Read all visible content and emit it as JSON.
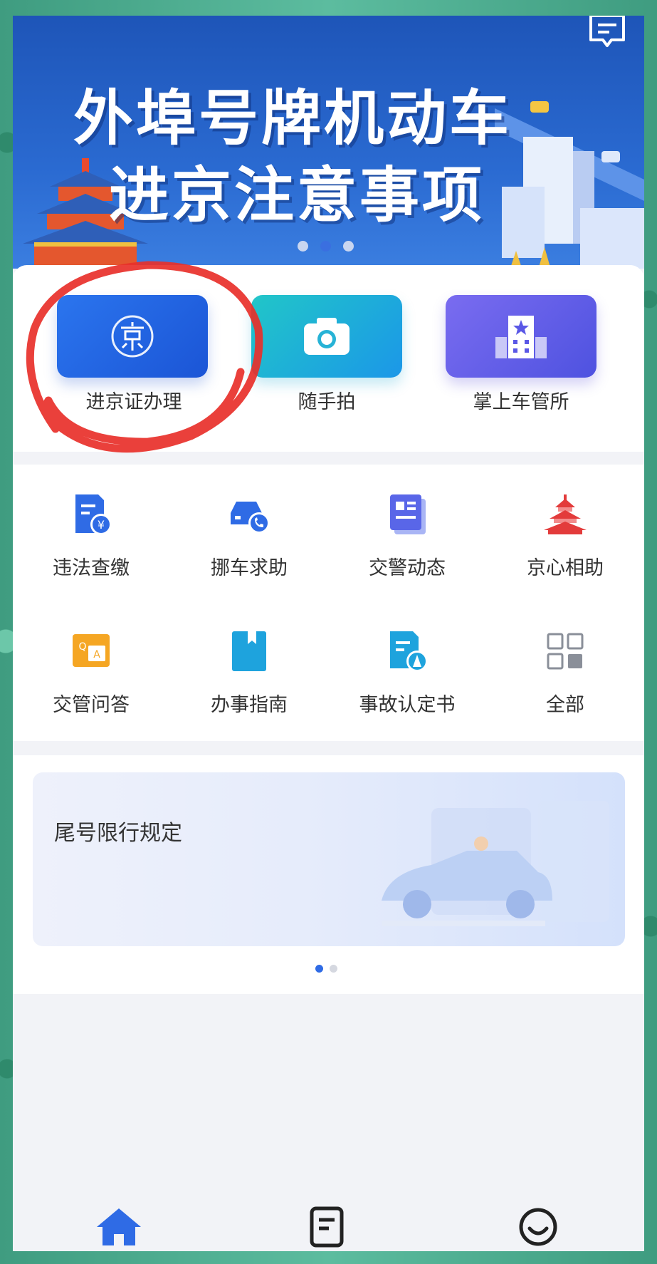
{
  "banner": {
    "title_line1": "外埠号牌机动车",
    "title_line2": "进京注意事项",
    "slides": 3,
    "active_slide": 2
  },
  "quick_actions": [
    {
      "label": "进京证办理",
      "icon": "jing-icon"
    },
    {
      "label": "随手拍",
      "icon": "camera-icon"
    },
    {
      "label": "掌上车管所",
      "icon": "building-icon"
    }
  ],
  "services": [
    {
      "label": "违法查缴",
      "icon": "fine-payment-icon"
    },
    {
      "label": "挪车求助",
      "icon": "car-call-icon"
    },
    {
      "label": "交警动态",
      "icon": "news-icon"
    },
    {
      "label": "京心相助",
      "icon": "temple-icon"
    },
    {
      "label": "交管问答",
      "icon": "qa-icon"
    },
    {
      "label": "办事指南",
      "icon": "guide-book-icon"
    },
    {
      "label": "事故认定书",
      "icon": "accident-report-icon"
    },
    {
      "label": "全部",
      "icon": "grid-all-icon"
    }
  ],
  "restriction": {
    "title": "尾号限行规定",
    "slides": 2,
    "active_slide": 1
  },
  "bottom_nav": [
    {
      "icon": "home-icon",
      "active": true
    },
    {
      "icon": "document-icon",
      "active": false
    },
    {
      "icon": "smile-icon",
      "active": false
    }
  ],
  "colors": {
    "accent": "#2f6be5",
    "annotation": "#e8302a"
  }
}
